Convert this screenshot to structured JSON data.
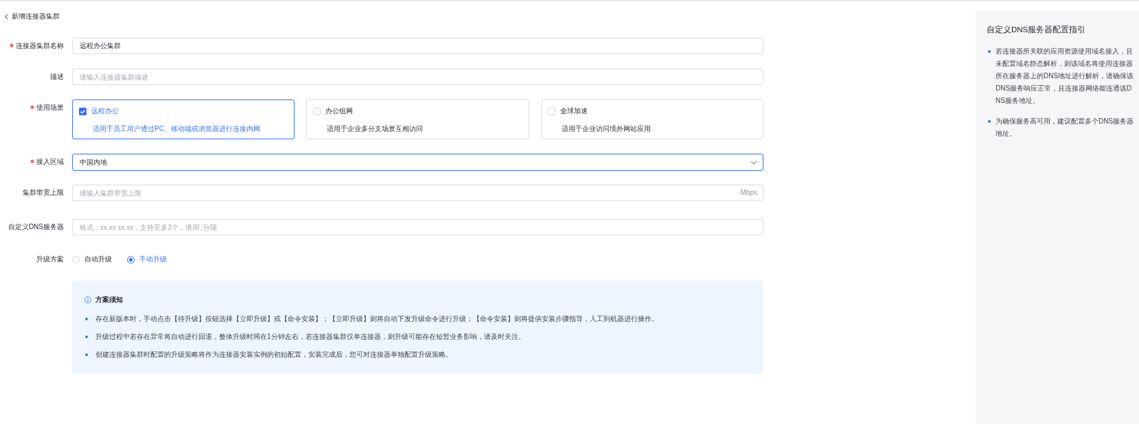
{
  "header": {
    "back_label": "新增连接器集群"
  },
  "form": {
    "fields": [
      {
        "kind": "text",
        "label": "连接器集群名称",
        "required": true,
        "value": "远程办公集群"
      },
      {
        "kind": "text",
        "label": "描述",
        "required": false,
        "placeholder": "请输入连接器集群描述"
      },
      {
        "kind": "cards",
        "label": "使用场景",
        "required": true,
        "options": [
          {
            "title": "远程办公",
            "description": "适用于员工用户通过PC、移动端或浏览器进行连接内网",
            "checked": true
          },
          {
            "title": "办公组网",
            "description": "适用于企业多分支场景互相访问",
            "checked": false
          },
          {
            "title": "全球加速",
            "description": "适用于企业访问境外网站应用",
            "checked": false
          }
        ]
      },
      {
        "kind": "select",
        "label": "接入区域",
        "required": true,
        "value": "中国内地",
        "focused": true
      },
      {
        "kind": "text",
        "label": "集群带宽上限",
        "required": false,
        "placeholder": "请输入集群带宽上限",
        "suffix": "Mbps"
      },
      {
        "kind": "text",
        "label": "自定义DNS服务器",
        "required": false,
        "placeholder": "格式：xx.xx.xx.xx，支持至多3个，请用','分隔"
      },
      {
        "kind": "radio",
        "label": "升级方案",
        "required": false,
        "options": [
          {
            "label": "自动升级",
            "selected": false
          },
          {
            "label": "手动升级",
            "selected": true
          }
        ]
      }
    ]
  },
  "notice": {
    "title": "方案须知",
    "items": [
      "存在新版本时，手动点击【待升级】按钮选择【立即升级】或【命令安装】；【立即升级】则将自动下发升级命令进行升级；【命令安装】则将提供安装步骤指导，人工到机器进行操作。",
      "升级过程中若存在异常将自动进行回退，整体升级时间在1分钟左右，若连接器集群仅单连接器，则升级可能存在短暂业务影响，请及时关注。",
      "创建连接器集群时配置的升级策略将作为连接器安装实例的初始配置，安装完成后，您可对连接器单独配置升级策略。"
    ]
  },
  "guide_panel": {
    "title": "自定义DNS服务器配置指引",
    "items": [
      "若连接器所关联的应用资源使用域名接入，且未配置域名静态解析，则该域名将使用连接器所在服务器上的DNS地址进行解析，请确保该DNS服务响应正常，且连接器网络能连通该DNS服务地址。",
      "为确保服务高可用，建议配置多个DNS服务器地址。"
    ]
  }
}
